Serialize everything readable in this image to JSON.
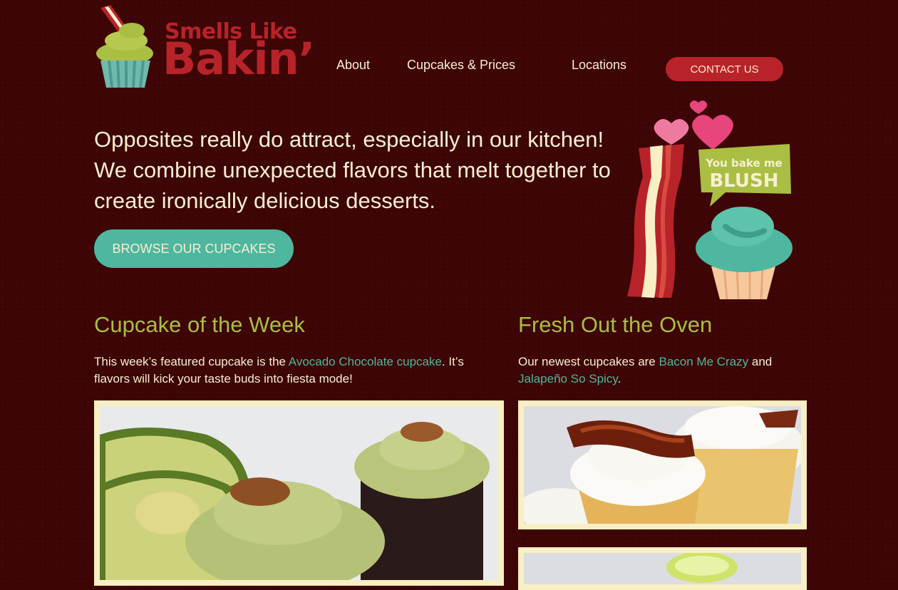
{
  "logo": {
    "line1": "Smells Like",
    "line2": "Bakin’"
  },
  "nav": {
    "items": [
      {
        "label": "About"
      },
      {
        "label": "Cupcakes & Prices"
      },
      {
        "label": "Locations"
      }
    ],
    "contact_label": "CONTACT US"
  },
  "hero": {
    "text": "Opposites really do attract, especially in our kitchen! We combine unexpected flavors that melt together to create ironically delicious desserts.",
    "button_label": "BROWSE OUR CUPCAKES",
    "badge_line1": "You bake me",
    "badge_line2": "BLUSH"
  },
  "cupcake_of_week": {
    "title": "Cupcake of the Week",
    "text_before": "This week’s featured cupcake is the ",
    "link": "Avocado Chocolate cupcake",
    "text_after": ". It’s flavors will kick your taste buds into fiesta mode!"
  },
  "fresh": {
    "title": "Fresh Out the Oven",
    "text_before": "Our newest cupcakes are ",
    "link1": "Bacon Me Crazy",
    "text_mid": " and ",
    "link2": "Jalapeño So Spicy",
    "text_after": "."
  },
  "colors": {
    "background": "#3d0505",
    "brand_red": "#b8232a",
    "teal": "#4fb7a0",
    "olive_green": "#a9be43",
    "cream": "#f7efcf"
  }
}
